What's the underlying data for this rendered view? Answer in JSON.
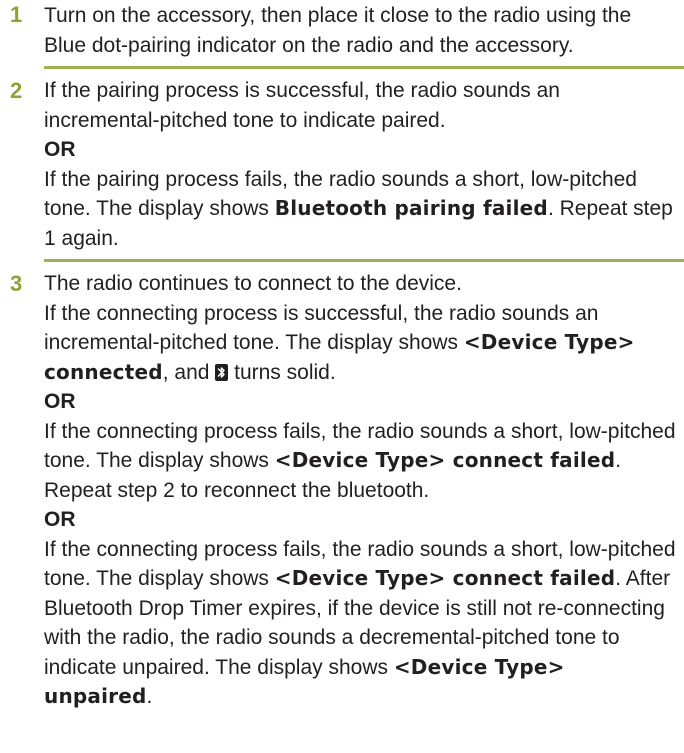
{
  "steps": [
    {
      "number": "1",
      "text": "Turn on the accessory, then place it close to the radio using the Blue dot-pairing indicator on the radio and the accessory."
    },
    {
      "number": "2",
      "success": "If the pairing process is successful, the radio sounds an incremental-pitched tone to indicate paired.",
      "or": "OR",
      "fail_pre": "If the pairing process fails, the radio sounds a short, low-pitched tone. The display shows ",
      "fail_display": "Bluetooth pairing failed",
      "fail_post": ". Repeat step 1 again."
    },
    {
      "number": "3",
      "intro": "The radio continues to connect to the device.",
      "success_pre": "If the connecting process is successful, the radio sounds an incremental-pitched tone. The display shows ",
      "success_display": "<Device Type> connected",
      "success_mid": ", and ",
      "success_post": " turns solid.",
      "or1": "OR",
      "fail1_pre": "If the connecting process fails, the radio sounds a short, low-pitched tone. The display shows ",
      "fail1_display": "<Device Type> connect failed",
      "fail1_post": ". Repeat step 2 to reconnect the bluetooth.",
      "or2": "OR",
      "fail2_pre": "If the connecting process fails, the radio sounds a short, low-pitched tone. The display shows ",
      "fail2_display": "<Device Type> connect failed",
      "fail2_mid": ". After Bluetooth Drop Timer expires, if the device is still not re-connecting with the radio, the radio sounds a decremental-pitched tone to indicate unpaired. The display shows ",
      "fail2_display2": "<Device Type> unpaired",
      "fail2_post": "."
    }
  ],
  "icons": {
    "status_icon": "bluetooth-icon"
  },
  "colors": {
    "step_number": "#8aa439",
    "divider": "#9eb356",
    "text": "#231f20"
  }
}
